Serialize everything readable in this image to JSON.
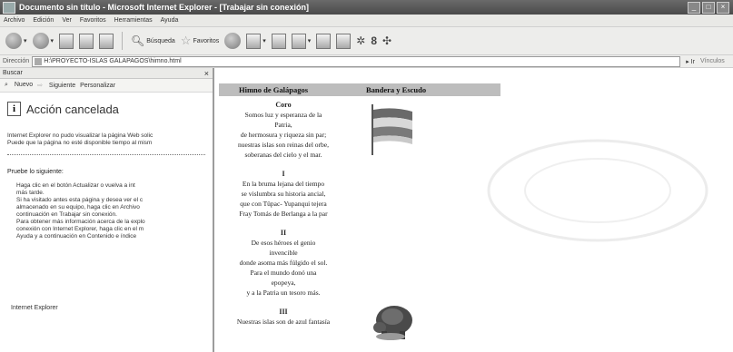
{
  "window": {
    "title": "Documento sin título - Microsoft Internet Explorer - [Trabajar sin conexión]"
  },
  "menu": [
    "Archivo",
    "Edición",
    "Ver",
    "Favoritos",
    "Herramientas",
    "Ayuda"
  ],
  "toolbar": {
    "search_label": "Búsqueda",
    "favorites_label": "Favoritos"
  },
  "address": {
    "label": "Dirección",
    "value": "H:\\PROYECTO-ISLAS GALAPAGOS\\himno.html",
    "go_label": "Ir",
    "links_label": "Vínculos"
  },
  "sidebar": {
    "title": "Buscar",
    "new_label": "Nuevo",
    "next_label": "Siguiente",
    "customize_label": "Personalizar",
    "error_title": "Acción cancelada",
    "error_line1": "Internet Explorer no pudo visualizar la página Web solic",
    "error_line2": "Puede que la página no esté disponible tiempo al mism",
    "try_label": "Pruebe lo siguiente:",
    "bullet1_a": "Haga clic en el botón  Actualizar o vuelva a int",
    "bullet1_b": "más tarde.",
    "bullet2_a": "Si ha visitado antes esta página y desea ver el c",
    "bullet2_b": "almacenado en su equipo, haga clic en Archivo",
    "bullet2_c": "continuación en Trabajar sin conexión.",
    "bullet3_a": "Para obtener más información acerca de la explo",
    "bullet3_b": "conexión con Internet Explorer, haga clic en el m",
    "bullet3_c": "Ayuda y a continuación en Contenido e índice",
    "footer": "Internet Explorer"
  },
  "document": {
    "col1_header": "Himno de Galápagos",
    "col2_header": "Bandera y Escudo",
    "coro_title": "Coro",
    "coro": [
      "Somos luz y esperanza de la",
      "Patria,",
      "de hermosura y riqueza sin par;",
      "nuestras islas son reinas del orbe,",
      "soberanas del cielo y el mar."
    ],
    "s1_title": "I",
    "s1": [
      "En la bruma lejana del tiempo",
      "se vislumbra su historia ancial,",
      "que con Tüpac- Yupanqui tejera",
      "Fray Tomás de Berlanga a la par"
    ],
    "s2_title": "II",
    "s2": [
      "De esos héroes el genio",
      "invencible",
      "donde asoma más fúlgido el sol.",
      "Para el mundo donó una",
      "epopeya,",
      "y a la Patria un tesoro más."
    ],
    "s3_title": "III",
    "s3": [
      "Nuestras islas son de azul fantasía"
    ]
  },
  "colors": {
    "flag_stripe_light": "#d8d8d8",
    "flag_stripe_dark": "#6a6a6a",
    "table_header": "#bdbdbd"
  }
}
